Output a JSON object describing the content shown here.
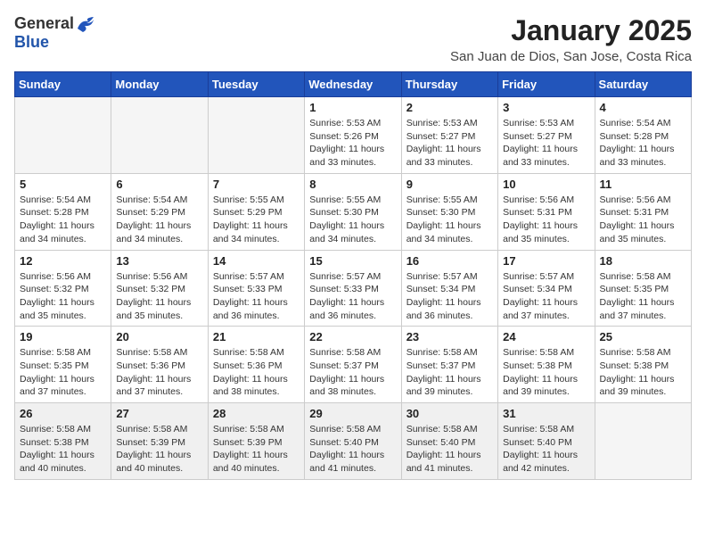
{
  "header": {
    "logo": {
      "general": "General",
      "blue": "Blue"
    },
    "title": "January 2025",
    "subtitle": "San Juan de Dios, San Jose, Costa Rica"
  },
  "weekdays": [
    "Sunday",
    "Monday",
    "Tuesday",
    "Wednesday",
    "Thursday",
    "Friday",
    "Saturday"
  ],
  "weeks": [
    [
      {
        "day": "",
        "empty": true
      },
      {
        "day": "",
        "empty": true
      },
      {
        "day": "",
        "empty": true
      },
      {
        "day": "1",
        "sunrise": "5:53 AM",
        "sunset": "5:26 PM",
        "daylight": "11 hours and 33 minutes."
      },
      {
        "day": "2",
        "sunrise": "5:53 AM",
        "sunset": "5:27 PM",
        "daylight": "11 hours and 33 minutes."
      },
      {
        "day": "3",
        "sunrise": "5:53 AM",
        "sunset": "5:27 PM",
        "daylight": "11 hours and 33 minutes."
      },
      {
        "day": "4",
        "sunrise": "5:54 AM",
        "sunset": "5:28 PM",
        "daylight": "11 hours and 33 minutes."
      }
    ],
    [
      {
        "day": "5",
        "sunrise": "5:54 AM",
        "sunset": "5:28 PM",
        "daylight": "11 hours and 34 minutes."
      },
      {
        "day": "6",
        "sunrise": "5:54 AM",
        "sunset": "5:29 PM",
        "daylight": "11 hours and 34 minutes."
      },
      {
        "day": "7",
        "sunrise": "5:55 AM",
        "sunset": "5:29 PM",
        "daylight": "11 hours and 34 minutes."
      },
      {
        "day": "8",
        "sunrise": "5:55 AM",
        "sunset": "5:30 PM",
        "daylight": "11 hours and 34 minutes."
      },
      {
        "day": "9",
        "sunrise": "5:55 AM",
        "sunset": "5:30 PM",
        "daylight": "11 hours and 34 minutes."
      },
      {
        "day": "10",
        "sunrise": "5:56 AM",
        "sunset": "5:31 PM",
        "daylight": "11 hours and 35 minutes."
      },
      {
        "day": "11",
        "sunrise": "5:56 AM",
        "sunset": "5:31 PM",
        "daylight": "11 hours and 35 minutes."
      }
    ],
    [
      {
        "day": "12",
        "sunrise": "5:56 AM",
        "sunset": "5:32 PM",
        "daylight": "11 hours and 35 minutes."
      },
      {
        "day": "13",
        "sunrise": "5:56 AM",
        "sunset": "5:32 PM",
        "daylight": "11 hours and 35 minutes."
      },
      {
        "day": "14",
        "sunrise": "5:57 AM",
        "sunset": "5:33 PM",
        "daylight": "11 hours and 36 minutes."
      },
      {
        "day": "15",
        "sunrise": "5:57 AM",
        "sunset": "5:33 PM",
        "daylight": "11 hours and 36 minutes."
      },
      {
        "day": "16",
        "sunrise": "5:57 AM",
        "sunset": "5:34 PM",
        "daylight": "11 hours and 36 minutes."
      },
      {
        "day": "17",
        "sunrise": "5:57 AM",
        "sunset": "5:34 PM",
        "daylight": "11 hours and 37 minutes."
      },
      {
        "day": "18",
        "sunrise": "5:58 AM",
        "sunset": "5:35 PM",
        "daylight": "11 hours and 37 minutes."
      }
    ],
    [
      {
        "day": "19",
        "sunrise": "5:58 AM",
        "sunset": "5:35 PM",
        "daylight": "11 hours and 37 minutes."
      },
      {
        "day": "20",
        "sunrise": "5:58 AM",
        "sunset": "5:36 PM",
        "daylight": "11 hours and 37 minutes."
      },
      {
        "day": "21",
        "sunrise": "5:58 AM",
        "sunset": "5:36 PM",
        "daylight": "11 hours and 38 minutes."
      },
      {
        "day": "22",
        "sunrise": "5:58 AM",
        "sunset": "5:37 PM",
        "daylight": "11 hours and 38 minutes."
      },
      {
        "day": "23",
        "sunrise": "5:58 AM",
        "sunset": "5:37 PM",
        "daylight": "11 hours and 39 minutes."
      },
      {
        "day": "24",
        "sunrise": "5:58 AM",
        "sunset": "5:38 PM",
        "daylight": "11 hours and 39 minutes."
      },
      {
        "day": "25",
        "sunrise": "5:58 AM",
        "sunset": "5:38 PM",
        "daylight": "11 hours and 39 minutes."
      }
    ],
    [
      {
        "day": "26",
        "sunrise": "5:58 AM",
        "sunset": "5:38 PM",
        "daylight": "11 hours and 40 minutes.",
        "lastrow": true
      },
      {
        "day": "27",
        "sunrise": "5:58 AM",
        "sunset": "5:39 PM",
        "daylight": "11 hours and 40 minutes.",
        "lastrow": true
      },
      {
        "day": "28",
        "sunrise": "5:58 AM",
        "sunset": "5:39 PM",
        "daylight": "11 hours and 40 minutes.",
        "lastrow": true
      },
      {
        "day": "29",
        "sunrise": "5:58 AM",
        "sunset": "5:40 PM",
        "daylight": "11 hours and 41 minutes.",
        "lastrow": true
      },
      {
        "day": "30",
        "sunrise": "5:58 AM",
        "sunset": "5:40 PM",
        "daylight": "11 hours and 41 minutes.",
        "lastrow": true
      },
      {
        "day": "31",
        "sunrise": "5:58 AM",
        "sunset": "5:40 PM",
        "daylight": "11 hours and 42 minutes.",
        "lastrow": true
      },
      {
        "day": "",
        "empty": true,
        "lastrow": true
      }
    ]
  ],
  "labels": {
    "sunrise": "Sunrise: ",
    "sunset": "Sunset: ",
    "daylight": "Daylight hours"
  }
}
